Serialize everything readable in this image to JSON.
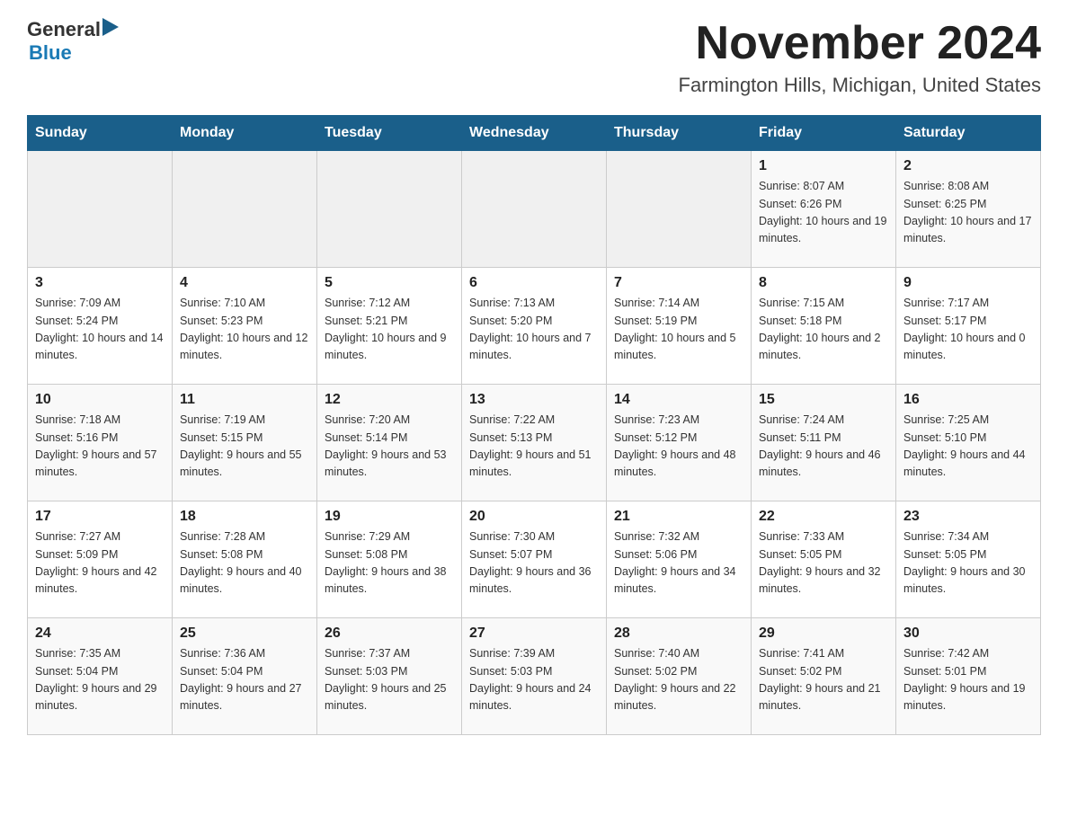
{
  "header": {
    "logo_general": "General",
    "logo_blue": "Blue",
    "month_title": "November 2024",
    "location": "Farmington Hills, Michigan, United States"
  },
  "weekdays": [
    "Sunday",
    "Monday",
    "Tuesday",
    "Wednesday",
    "Thursday",
    "Friday",
    "Saturday"
  ],
  "weeks": [
    [
      {
        "day": "",
        "sunrise": "",
        "sunset": "",
        "daylight": ""
      },
      {
        "day": "",
        "sunrise": "",
        "sunset": "",
        "daylight": ""
      },
      {
        "day": "",
        "sunrise": "",
        "sunset": "",
        "daylight": ""
      },
      {
        "day": "",
        "sunrise": "",
        "sunset": "",
        "daylight": ""
      },
      {
        "day": "",
        "sunrise": "",
        "sunset": "",
        "daylight": ""
      },
      {
        "day": "1",
        "sunrise": "Sunrise: 8:07 AM",
        "sunset": "Sunset: 6:26 PM",
        "daylight": "Daylight: 10 hours and 19 minutes."
      },
      {
        "day": "2",
        "sunrise": "Sunrise: 8:08 AM",
        "sunset": "Sunset: 6:25 PM",
        "daylight": "Daylight: 10 hours and 17 minutes."
      }
    ],
    [
      {
        "day": "3",
        "sunrise": "Sunrise: 7:09 AM",
        "sunset": "Sunset: 5:24 PM",
        "daylight": "Daylight: 10 hours and 14 minutes."
      },
      {
        "day": "4",
        "sunrise": "Sunrise: 7:10 AM",
        "sunset": "Sunset: 5:23 PM",
        "daylight": "Daylight: 10 hours and 12 minutes."
      },
      {
        "day": "5",
        "sunrise": "Sunrise: 7:12 AM",
        "sunset": "Sunset: 5:21 PM",
        "daylight": "Daylight: 10 hours and 9 minutes."
      },
      {
        "day": "6",
        "sunrise": "Sunrise: 7:13 AM",
        "sunset": "Sunset: 5:20 PM",
        "daylight": "Daylight: 10 hours and 7 minutes."
      },
      {
        "day": "7",
        "sunrise": "Sunrise: 7:14 AM",
        "sunset": "Sunset: 5:19 PM",
        "daylight": "Daylight: 10 hours and 5 minutes."
      },
      {
        "day": "8",
        "sunrise": "Sunrise: 7:15 AM",
        "sunset": "Sunset: 5:18 PM",
        "daylight": "Daylight: 10 hours and 2 minutes."
      },
      {
        "day": "9",
        "sunrise": "Sunrise: 7:17 AM",
        "sunset": "Sunset: 5:17 PM",
        "daylight": "Daylight: 10 hours and 0 minutes."
      }
    ],
    [
      {
        "day": "10",
        "sunrise": "Sunrise: 7:18 AM",
        "sunset": "Sunset: 5:16 PM",
        "daylight": "Daylight: 9 hours and 57 minutes."
      },
      {
        "day": "11",
        "sunrise": "Sunrise: 7:19 AM",
        "sunset": "Sunset: 5:15 PM",
        "daylight": "Daylight: 9 hours and 55 minutes."
      },
      {
        "day": "12",
        "sunrise": "Sunrise: 7:20 AM",
        "sunset": "Sunset: 5:14 PM",
        "daylight": "Daylight: 9 hours and 53 minutes."
      },
      {
        "day": "13",
        "sunrise": "Sunrise: 7:22 AM",
        "sunset": "Sunset: 5:13 PM",
        "daylight": "Daylight: 9 hours and 51 minutes."
      },
      {
        "day": "14",
        "sunrise": "Sunrise: 7:23 AM",
        "sunset": "Sunset: 5:12 PM",
        "daylight": "Daylight: 9 hours and 48 minutes."
      },
      {
        "day": "15",
        "sunrise": "Sunrise: 7:24 AM",
        "sunset": "Sunset: 5:11 PM",
        "daylight": "Daylight: 9 hours and 46 minutes."
      },
      {
        "day": "16",
        "sunrise": "Sunrise: 7:25 AM",
        "sunset": "Sunset: 5:10 PM",
        "daylight": "Daylight: 9 hours and 44 minutes."
      }
    ],
    [
      {
        "day": "17",
        "sunrise": "Sunrise: 7:27 AM",
        "sunset": "Sunset: 5:09 PM",
        "daylight": "Daylight: 9 hours and 42 minutes."
      },
      {
        "day": "18",
        "sunrise": "Sunrise: 7:28 AM",
        "sunset": "Sunset: 5:08 PM",
        "daylight": "Daylight: 9 hours and 40 minutes."
      },
      {
        "day": "19",
        "sunrise": "Sunrise: 7:29 AM",
        "sunset": "Sunset: 5:08 PM",
        "daylight": "Daylight: 9 hours and 38 minutes."
      },
      {
        "day": "20",
        "sunrise": "Sunrise: 7:30 AM",
        "sunset": "Sunset: 5:07 PM",
        "daylight": "Daylight: 9 hours and 36 minutes."
      },
      {
        "day": "21",
        "sunrise": "Sunrise: 7:32 AM",
        "sunset": "Sunset: 5:06 PM",
        "daylight": "Daylight: 9 hours and 34 minutes."
      },
      {
        "day": "22",
        "sunrise": "Sunrise: 7:33 AM",
        "sunset": "Sunset: 5:05 PM",
        "daylight": "Daylight: 9 hours and 32 minutes."
      },
      {
        "day": "23",
        "sunrise": "Sunrise: 7:34 AM",
        "sunset": "Sunset: 5:05 PM",
        "daylight": "Daylight: 9 hours and 30 minutes."
      }
    ],
    [
      {
        "day": "24",
        "sunrise": "Sunrise: 7:35 AM",
        "sunset": "Sunset: 5:04 PM",
        "daylight": "Daylight: 9 hours and 29 minutes."
      },
      {
        "day": "25",
        "sunrise": "Sunrise: 7:36 AM",
        "sunset": "Sunset: 5:04 PM",
        "daylight": "Daylight: 9 hours and 27 minutes."
      },
      {
        "day": "26",
        "sunrise": "Sunrise: 7:37 AM",
        "sunset": "Sunset: 5:03 PM",
        "daylight": "Daylight: 9 hours and 25 minutes."
      },
      {
        "day": "27",
        "sunrise": "Sunrise: 7:39 AM",
        "sunset": "Sunset: 5:03 PM",
        "daylight": "Daylight: 9 hours and 24 minutes."
      },
      {
        "day": "28",
        "sunrise": "Sunrise: 7:40 AM",
        "sunset": "Sunset: 5:02 PM",
        "daylight": "Daylight: 9 hours and 22 minutes."
      },
      {
        "day": "29",
        "sunrise": "Sunrise: 7:41 AM",
        "sunset": "Sunset: 5:02 PM",
        "daylight": "Daylight: 9 hours and 21 minutes."
      },
      {
        "day": "30",
        "sunrise": "Sunrise: 7:42 AM",
        "sunset": "Sunset: 5:01 PM",
        "daylight": "Daylight: 9 hours and 19 minutes."
      }
    ]
  ]
}
